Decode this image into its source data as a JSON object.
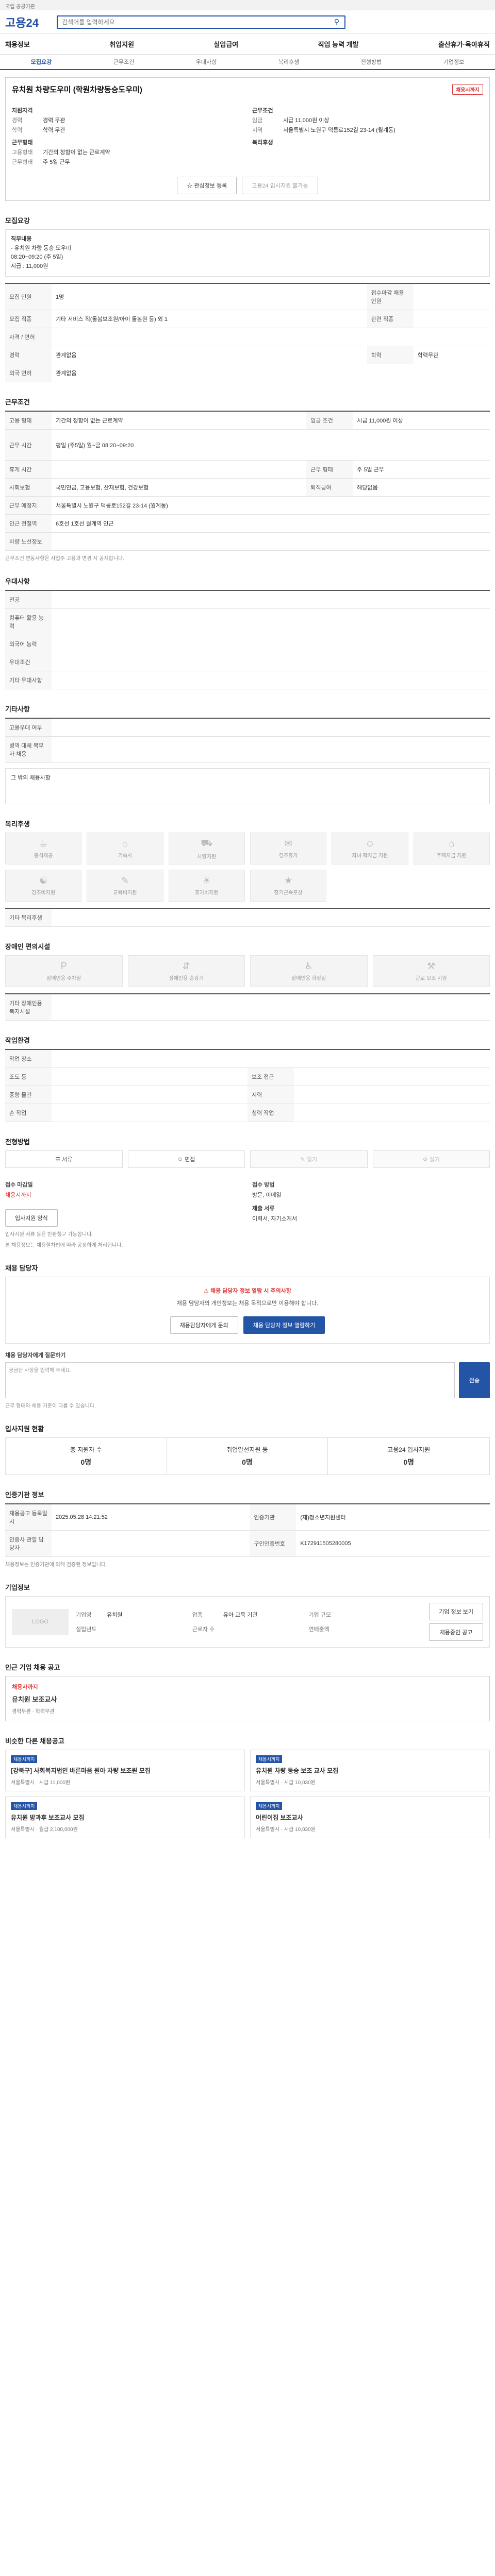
{
  "topbar": {
    "text": "국립 공공기관"
  },
  "header": {
    "logo": "고용24",
    "search_placeholder": "검색어를 입력하세요"
  },
  "nav": [
    "채용정보",
    "취업지원",
    "실업급여",
    "직업 능력 개발",
    "출산휴가·육아휴직"
  ],
  "subnav": [
    "모집요강",
    "근무조건",
    "우대사항",
    "복리후생",
    "전형방법",
    "기업정보"
  ],
  "job": {
    "title": "유치원 차량도우미 (학원차량동승도우미)",
    "badge": "채용시까지",
    "left_head": "지원자격",
    "career_k": "경력",
    "career_v": "경력 무관",
    "edu_k": "학력",
    "edu_v": "학력 무관",
    "work_head": "근무형태",
    "worktype_k": "고용형태",
    "worktype_v": "기간의 정함이 없는 근로계약",
    "workday_k": "근무형태",
    "workday_v": "주 5일 근무",
    "right_head": "근무조건",
    "wage_k": "임금",
    "wage_v": "시급 11,000원 이상",
    "loc_k": "지역",
    "loc_v": "서울특별시 노원구 덕릉로152길 23-14 (월계동)",
    "welfare_head": "복리후생",
    "btn_interest": "관심정보 등록",
    "btn_apply": "고용24 입사지원 불가능"
  },
  "recruit": {
    "title": "모집요강",
    "desc_head": "직무내용",
    "desc_lines": [
      "- 유치원 차량 동승 도우미",
      "  08:20~09:20 (주 5일)",
      "  시급 : 11,000원"
    ],
    "rows": [
      {
        "k1": "모집 인원",
        "v1": "1명",
        "k2": "접수마감 채용 인원",
        "v2": ""
      },
      {
        "k1": "모집 직종",
        "v1": "기타 서비스 직(돌봄보조원/아이 돌봄원 등) 외 1",
        "k2": "관련 직종",
        "v2": ""
      },
      {
        "k1": "자격 / 면허",
        "v1": "",
        "k2": "",
        "v2": ""
      },
      {
        "k1": "경력",
        "v1": "관계없음",
        "k2": "학력",
        "v2": "학력무관"
      },
      {
        "k1": "외국 면허",
        "v1": "관계없음",
        "k2": "",
        "v2": ""
      }
    ]
  },
  "conditions": {
    "title": "근무조건",
    "rows": [
      {
        "k1": "고용 형태",
        "v1": "기간의 정함이 없는 근로계약",
        "k2": "임금 조건",
        "v2": "시급 11,000원 이상"
      },
      {
        "k1": "근무 시간",
        "v1": "평일 (주5일) 월~금 08:20~09:20",
        "k2": "",
        "v2": ""
      },
      {
        "k1": "휴게 시간",
        "v1": "",
        "k2": "근무 형태",
        "v2": "주 5일 근무"
      },
      {
        "k1": "사회보험",
        "v1": "국민연금, 고용보험, 산재보험, 건강보험",
        "k2": "퇴직급여",
        "v2": "해당없음"
      },
      {
        "k1": "근무 예정지",
        "v1": "서울특별시 노원구 덕릉로152길 23-14 (월계동)",
        "k2": "",
        "v2": ""
      },
      {
        "k1": "인근 전철역",
        "v1": "6호선 1호선 월계역 인근",
        "k2": "",
        "v2": ""
      },
      {
        "k1": "차량 노선정보",
        "v1": "",
        "k2": "",
        "v2": ""
      }
    ],
    "note": "근무조건 변동사항은 사업주 고용과 변경 시 공지합니다."
  },
  "preferred": {
    "title": "우대사항",
    "rows": [
      "전공",
      "컴퓨터 활용 능력",
      "외국어 능력",
      "우대조건",
      "기타 우대사항"
    ]
  },
  "etc": {
    "title": "기타사항",
    "rows": [
      "고용우대 여부",
      "병역 대체 복무자 채용"
    ],
    "box_head": "그 밖의 채용사항"
  },
  "welfare": {
    "title": "복리후생",
    "items": [
      "중식제공",
      "기숙사",
      "차량지원",
      "경조휴가",
      "자녀 학자금 지원",
      "주택자금 지원",
      "경조비지원",
      "교육비지원",
      "휴가비지원",
      "장기근속포상",
      "",
      ""
    ],
    "etc_head": "기타 복리후생"
  },
  "facility": {
    "title": "장애인 편의시설",
    "items": [
      "장애인용 주차장",
      "장애인용 승강기",
      "장애인용 화장실",
      "근로 보조 지원"
    ],
    "etc_head": "기타 장애인용 복지시설"
  },
  "environment": {
    "title": "작업환경",
    "rows": [
      {
        "k1": "작업 장소",
        "v1": "",
        "k2": "",
        "v2": ""
      },
      {
        "k1": "조도 등",
        "v1": "",
        "k2": "보조 접근",
        "v2": ""
      },
      {
        "k1": "중량 물건",
        "v1": "",
        "k2": "시력",
        "v2": ""
      },
      {
        "k1": "손 작업",
        "v1": "",
        "k2": "청력 작업",
        "v2": ""
      }
    ]
  },
  "selection": {
    "title": "전형방법",
    "methods": [
      "서류",
      "면접",
      "필기",
      "실기"
    ],
    "period_head": "접수 마감일",
    "period": "채용시까지",
    "how_head": "접수 방법",
    "how": "방문, 이메일",
    "docs_head": "제출 서류",
    "docs": "이력서, 자기소개서",
    "btn_form": "입사지원 양식",
    "notes": [
      "입사지원 서류 등은 반환청구 가능합니다.",
      "본 채용정보는 채용절차법에 따라 공정하게 처리됩니다."
    ]
  },
  "contact": {
    "title": "채용 담당자",
    "alert_red": "채용 담당자 정보 열람 시 주의사항",
    "alert_line": "채용 담당자의 개인정보는 채용 목적으로만 이용해야 합니다.",
    "btn_a": "채용담당자에게 문의",
    "btn_b": "채용 담당자 정보 열람하기",
    "inquiry_head": "채용 담당자에게 질문하기",
    "inquiry_placeholder": "궁금한 사항을 입력해 주세요.",
    "inquiry_btn": "전송",
    "notes": [
      "근무 형태와 채용 기준이 다를 수 있습니다."
    ]
  },
  "applicants": {
    "title": "입사지원 현황",
    "stats": [
      {
        "label": "총 지원자 수",
        "num": "0명"
      },
      {
        "label": "취업알선지원 등",
        "num": "0명"
      },
      {
        "label": "고용24 입사지원",
        "num": "0명"
      }
    ]
  },
  "board": {
    "title": "인증기관 정보",
    "rows": [
      {
        "k1": "채용공고 등록일시",
        "v1": "2025.05.28 14:21:52",
        "k2": "인증기관",
        "v2": "(재)청소년지원센터"
      },
      {
        "k1": "인증사 관할 담당자",
        "v1": "",
        "k2": "구인인증번호",
        "v2": "K172911505280005"
      }
    ],
    "note": "채용정보는 인증기관에 의해 검증된 정보입니다."
  },
  "company": {
    "title": "기업정보",
    "logo": "LOGO",
    "rows": [
      {
        "k": "기업명",
        "v": "유치원"
      },
      {
        "k": "업종",
        "v": "유아 교육 기관"
      },
      {
        "k": "기업 규모",
        "v": ""
      },
      {
        "k": "설립년도",
        "v": ""
      },
      {
        "k": "근로자 수",
        "v": ""
      },
      {
        "k": "연매출액",
        "v": ""
      }
    ],
    "btn_more": "기업 정보 보기",
    "btn_jobs": "채용중인 공고"
  },
  "other_company": {
    "title": "인근 기업 채용 공고",
    "name": "채용사까지",
    "sub": "유치원 보조교사",
    "tags": [
      "경력무관",
      "학력무관"
    ]
  },
  "others": {
    "title": "비슷한 다른 채용공고",
    "items": [
      {
        "tag": "채용시까지",
        "title": "[강북구] 사회복지법인 바른마음 원아 차량 보조원 모집",
        "meta": "서울특별시 · 시급 11,000원"
      },
      {
        "tag": "채용시까지",
        "title": "유치원 차량 동승 보조 교사 모집",
        "meta": "서울특별시 · 시급 10,030원"
      },
      {
        "tag": "채용시까지",
        "title": "유치원 방과후 보조교사 모집",
        "meta": "서울특별시 · 월급 2,100,000원"
      },
      {
        "tag": "채용시까지",
        "title": "어린이집 보조교사",
        "meta": "서울특별시 · 시급 10,030원"
      }
    ]
  }
}
